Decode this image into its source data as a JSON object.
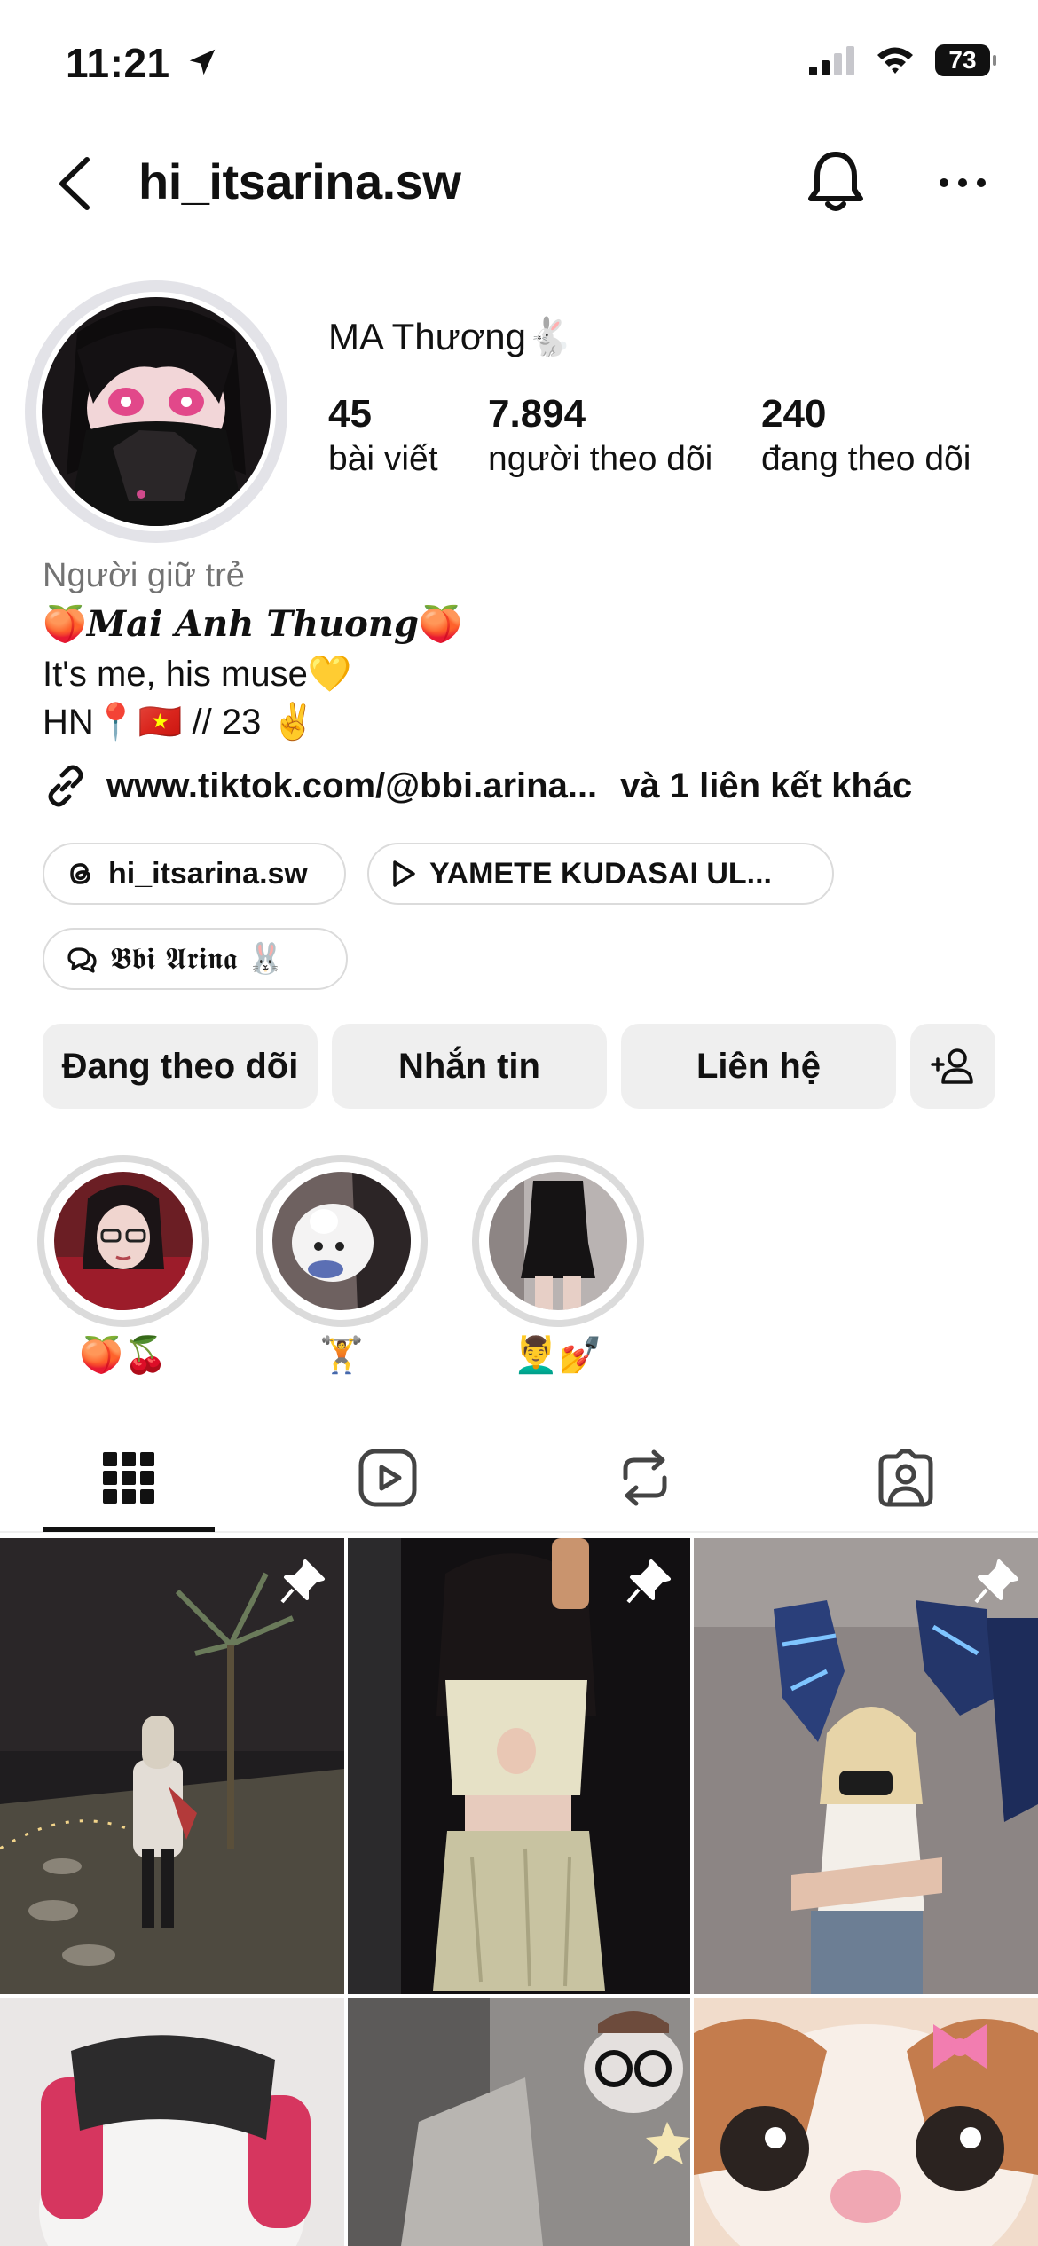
{
  "status_bar": {
    "time": "11:21",
    "battery": "73"
  },
  "header": {
    "username": "hi_itsarina.sw"
  },
  "profile": {
    "display_name": "MA Thương🐇",
    "stats": [
      {
        "value": "45",
        "label": "bài viết"
      },
      {
        "value": "7.894",
        "label": "người theo dõi"
      },
      {
        "value": "240",
        "label": "đang theo dõi"
      }
    ],
    "category": "Người giữ trẻ",
    "bio": {
      "line1_emoji_left": "🍑",
      "line1_name": "Mai Anh Thuong",
      "line1_emoji_right": "🍑",
      "line2": "It's me, his muse💛",
      "line3": "HN📍🇻🇳 // 23 ✌️"
    },
    "link": {
      "url": "www.tiktok.com/@bbi.arina...",
      "extra": "và 1 liên kết khác"
    },
    "chips": [
      {
        "label": "hi_itsarina.sw"
      },
      {
        "label": "YAMETE KUDASAI UL..."
      },
      {
        "label": "𝕭𝖇𝖎 𝕬𝖗𝖎𝖓𝖆 🐰"
      }
    ]
  },
  "actions": {
    "following": "Đang theo dõi",
    "message": "Nhắn tin",
    "contact": "Liên hệ"
  },
  "highlights": [
    {
      "label": "🍑🍒"
    },
    {
      "label": "🏋️"
    },
    {
      "label": "💆‍♂️💅"
    }
  ],
  "colors": {
    "button_bg": "#efefef",
    "accent": "#111111",
    "muted": "#737373",
    "ring": "#dbdbdb"
  }
}
